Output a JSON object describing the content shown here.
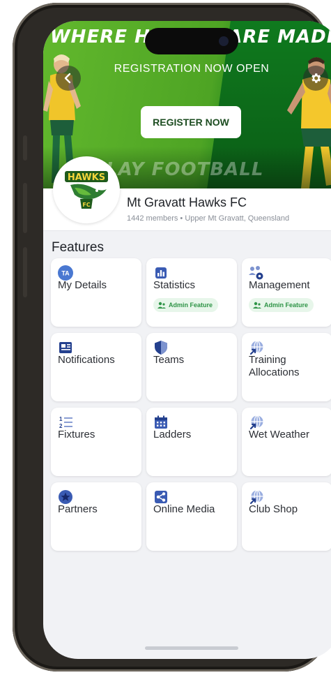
{
  "banner": {
    "headline": "WHERE HEROES ARE MADE",
    "subtitle": "REGISTRATION NOW OPEN",
    "cta_label": "REGISTER NOW",
    "footer_text": "PLAY FOOTBALL"
  },
  "club": {
    "name": "Mt Gravatt Hawks FC",
    "meta": "1442 members • Upper Mt Gravatt, Queensland",
    "logo_text": "HAWKS",
    "logo_subtext": "FC"
  },
  "features": {
    "title": "Features",
    "items": [
      {
        "label": "My Details",
        "icon": "user-initials-icon",
        "initials": "TA",
        "badge": ""
      },
      {
        "label": "Statistics",
        "icon": "bar-chart-icon",
        "badge": "Admin Feature"
      },
      {
        "label": "Management",
        "icon": "people-gear-icon",
        "badge": "Admin Feature"
      },
      {
        "label": "Notifications",
        "icon": "newspaper-icon",
        "badge": ""
      },
      {
        "label": "Teams",
        "icon": "shield-icon",
        "badge": ""
      },
      {
        "label": "Training Allocations",
        "icon": "globe-link-icon",
        "badge": ""
      },
      {
        "label": "Fixtures",
        "icon": "numbered-list-icon",
        "badge": ""
      },
      {
        "label": "Ladders",
        "icon": "calendar-icon",
        "badge": ""
      },
      {
        "label": "Wet Weather",
        "icon": "globe-link-icon",
        "badge": ""
      },
      {
        "label": "Partners",
        "icon": "star-icon",
        "badge": ""
      },
      {
        "label": "Online Media",
        "icon": "share-icon",
        "badge": ""
      },
      {
        "label": "Club Shop",
        "icon": "globe-link-icon",
        "badge": ""
      }
    ]
  },
  "colors": {
    "accent_blue": "#24408e",
    "badge_green": "#2f9447",
    "banner_green": "#4ea424"
  }
}
